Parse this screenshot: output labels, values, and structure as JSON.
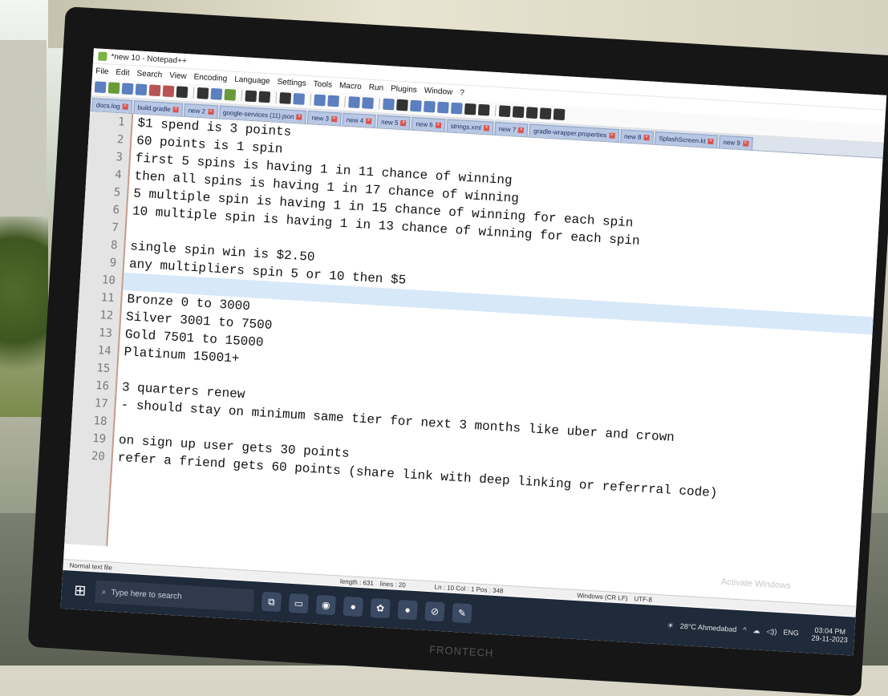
{
  "window": {
    "title": "*new 10 - Notepad++"
  },
  "menu": [
    "File",
    "Edit",
    "Search",
    "View",
    "Encoding",
    "Language",
    "Settings",
    "Tools",
    "Macro",
    "Run",
    "Plugins",
    "Window",
    "?"
  ],
  "tabs": [
    {
      "label": "docs.log",
      "active": false
    },
    {
      "label": "build.gradle",
      "active": false
    },
    {
      "label": "new 2",
      "active": false
    },
    {
      "label": "google-services (11).json",
      "active": false
    },
    {
      "label": "new 3",
      "active": false
    },
    {
      "label": "new 4",
      "active": false
    },
    {
      "label": "new 5",
      "active": false
    },
    {
      "label": "new 6",
      "active": false
    },
    {
      "label": "strings.xml",
      "active": false
    },
    {
      "label": "new 7",
      "active": false
    },
    {
      "label": "gradle-wrapper.properties",
      "active": false
    },
    {
      "label": "new 8",
      "active": false
    },
    {
      "label": "SplashScreen.kt",
      "active": false
    },
    {
      "label": "new 9",
      "active": false
    }
  ],
  "editor": {
    "current_line": 10,
    "lines": [
      "$1 spend is 3 points",
      "60 points is 1 spin",
      "first 5 spins is having 1 in 11 chance of winning",
      "then all spins is having 1 in 17 chance of winning",
      "5 multiple spin is having 1 in 15 chance of winning for each spin",
      "10 multiple spin is having 1 in 13 chance of winning for each spin",
      "",
      "single spin win is $2.50",
      "any multipliers spin 5 or 10 then $5",
      "",
      "Bronze 0 to 3000",
      "Silver 3001 to 7500",
      "Gold 7501 to 15000",
      "Platinum 15001+",
      "",
      "3 quarters renew",
      "- should stay on minimum same tier for next 3 months like uber and crown",
      "",
      "on sign up user gets 30 points",
      "refer a friend gets 60 points (share link with deep linking or referrral code)"
    ],
    "line_numbers": [
      "1",
      "2",
      "3",
      "4",
      "5",
      "6",
      "7",
      "8",
      "9",
      "10",
      "11",
      "12",
      "13",
      "14",
      "15",
      "16",
      "17",
      "18",
      "19",
      "20"
    ]
  },
  "status": {
    "file_type": "Normal text file",
    "length": "length : 631",
    "lines": "lines : 20",
    "position": "Ln : 10    Col : 1    Pos : 348",
    "eol": "Windows (CR LF)",
    "encoding": "UTF-8"
  },
  "watermark": "Activate Windows",
  "taskbar": {
    "search_placeholder": "Type here to search",
    "weather": "28°C  Ahmedabad",
    "lang": "ENG",
    "time": "03:04 PM",
    "date": "29-11-2023"
  },
  "monitor_brand": "FRONTECH"
}
